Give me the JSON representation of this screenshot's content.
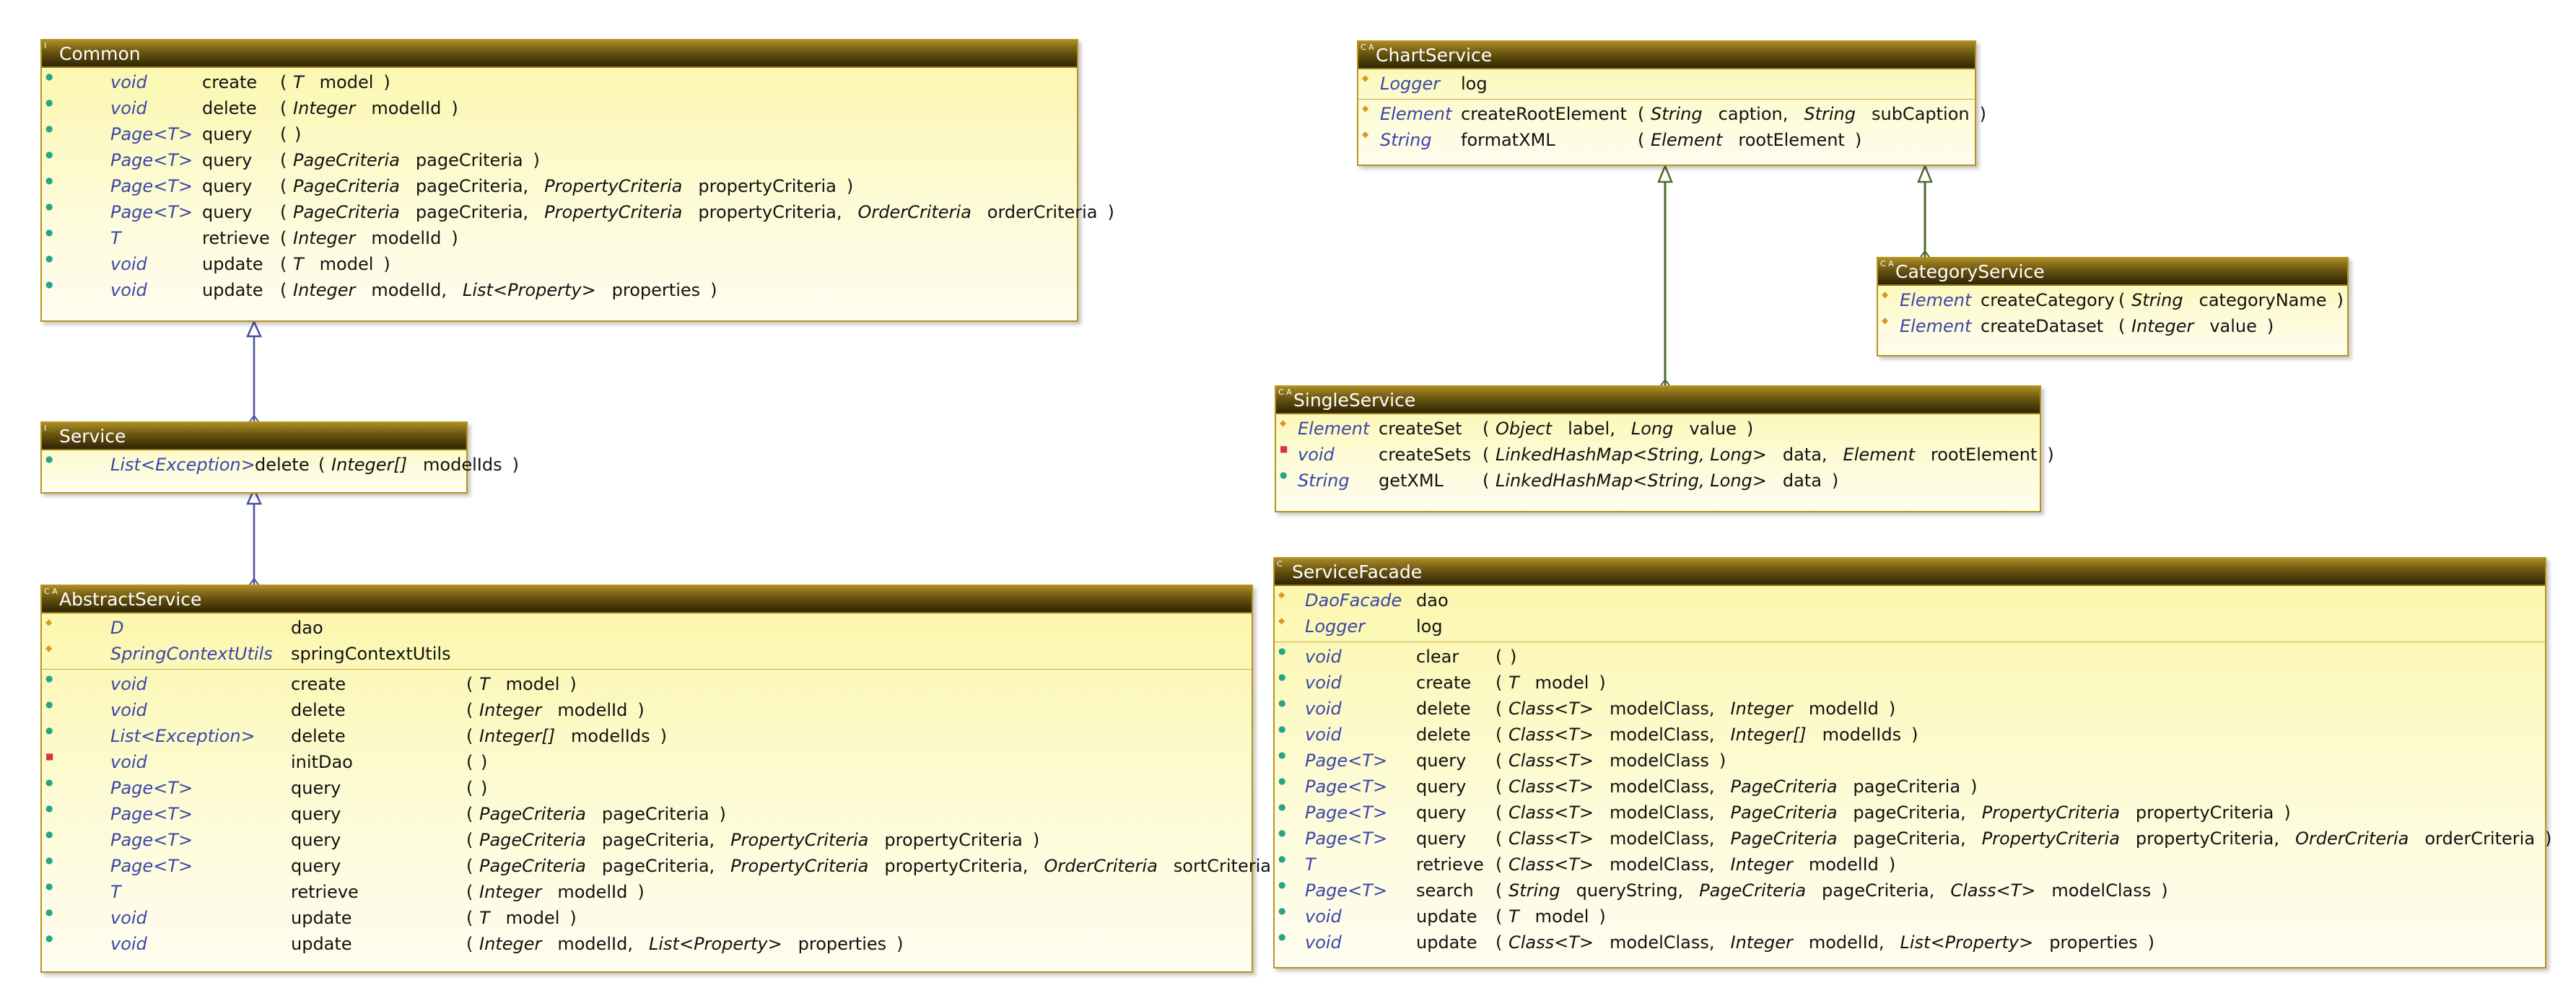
{
  "classes": {
    "common": {
      "name": "Common",
      "badge": "I",
      "operations": [
        {
          "vis": "+",
          "type": "void",
          "name": "create",
          "params": [
            {
              "t": "T",
              "n": "model"
            }
          ]
        },
        {
          "vis": "+",
          "type": "void",
          "name": "delete",
          "params": [
            {
              "t": "Integer",
              "n": "modelId"
            }
          ]
        },
        {
          "vis": "+",
          "type": "Page<T>",
          "name": "query",
          "params": []
        },
        {
          "vis": "+",
          "type": "Page<T>",
          "name": "query",
          "params": [
            {
              "t": "PageCriteria",
              "n": "pageCriteria"
            }
          ]
        },
        {
          "vis": "+",
          "type": "Page<T>",
          "name": "query",
          "params": [
            {
              "t": "PageCriteria",
              "n": "pageCriteria,"
            },
            {
              "t": "PropertyCriteria",
              "n": "propertyCriteria"
            }
          ]
        },
        {
          "vis": "+",
          "type": "Page<T>",
          "name": "query",
          "params": [
            {
              "t": "PageCriteria",
              "n": "pageCriteria,"
            },
            {
              "t": "PropertyCriteria",
              "n": "propertyCriteria,"
            },
            {
              "t": "OrderCriteria",
              "n": "orderCriteria"
            }
          ]
        },
        {
          "vis": "+",
          "type": "T",
          "name": "retrieve",
          "params": [
            {
              "t": "Integer",
              "n": "modelId"
            }
          ]
        },
        {
          "vis": "+",
          "type": "void",
          "name": "update",
          "params": [
            {
              "t": "T",
              "n": "model"
            }
          ]
        },
        {
          "vis": "+",
          "type": "void",
          "name": "update",
          "params": [
            {
              "t": "Integer",
              "n": "modelId,"
            },
            {
              "t": "List<Property>",
              "n": "properties"
            }
          ]
        }
      ]
    },
    "service": {
      "name": "Service",
      "badge": "I",
      "operations": [
        {
          "vis": "+",
          "type": "List<Exception>",
          "name": "delete",
          "params": [
            {
              "t": "Integer[]",
              "n": "modelIds"
            }
          ]
        }
      ]
    },
    "abstract_service": {
      "name": "AbstractService",
      "badge": "C A",
      "fields": [
        {
          "vis": "#",
          "type": "D",
          "name": "dao"
        },
        {
          "vis": "#",
          "type": "SpringContextUtils",
          "name": "springContextUtils"
        }
      ],
      "operations": [
        {
          "vis": "+",
          "type": "void",
          "name": "create",
          "params": [
            {
              "t": "T",
              "n": "model"
            }
          ]
        },
        {
          "vis": "+",
          "type": "void",
          "name": "delete",
          "params": [
            {
              "t": "Integer",
              "n": "modelId"
            }
          ]
        },
        {
          "vis": "+",
          "type": "List<Exception>",
          "name": "delete",
          "params": [
            {
              "t": "Integer[]",
              "n": "modelIds"
            }
          ]
        },
        {
          "vis": "-",
          "type": "void",
          "name": "initDao",
          "params": []
        },
        {
          "vis": "+",
          "type": "Page<T>",
          "name": "query",
          "params": []
        },
        {
          "vis": "+",
          "type": "Page<T>",
          "name": "query",
          "params": [
            {
              "t": "PageCriteria",
              "n": "pageCriteria"
            }
          ]
        },
        {
          "vis": "+",
          "type": "Page<T>",
          "name": "query",
          "params": [
            {
              "t": "PageCriteria",
              "n": "pageCriteria,"
            },
            {
              "t": "PropertyCriteria",
              "n": "propertyCriteria"
            }
          ]
        },
        {
          "vis": "+",
          "type": "Page<T>",
          "name": "query",
          "params": [
            {
              "t": "PageCriteria",
              "n": "pageCriteria,"
            },
            {
              "t": "PropertyCriteria",
              "n": "propertyCriteria,"
            },
            {
              "t": "OrderCriteria",
              "n": "sortCriteria"
            }
          ]
        },
        {
          "vis": "+",
          "type": "T",
          "name": "retrieve",
          "params": [
            {
              "t": "Integer",
              "n": "modelId"
            }
          ]
        },
        {
          "vis": "+",
          "type": "void",
          "name": "update",
          "params": [
            {
              "t": "T",
              "n": "model"
            }
          ]
        },
        {
          "vis": "+",
          "type": "void",
          "name": "update",
          "params": [
            {
              "t": "Integer",
              "n": "modelId,"
            },
            {
              "t": "List<Property>",
              "n": "properties"
            }
          ]
        }
      ]
    },
    "chart_service": {
      "name": "ChartService",
      "badge": "C A",
      "fields": [
        {
          "vis": "#",
          "type": "Logger",
          "name": "log"
        }
      ],
      "operations": [
        {
          "vis": "#",
          "type": "Element",
          "name": "createRootElement",
          "params": [
            {
              "t": "String",
              "n": "caption,"
            },
            {
              "t": "String",
              "n": "subCaption"
            }
          ]
        },
        {
          "vis": "#",
          "type": "String",
          "name": "formatXML",
          "params": [
            {
              "t": "Element",
              "n": "rootElement"
            }
          ]
        }
      ]
    },
    "category_service": {
      "name": "CategoryService",
      "badge": "C A",
      "operations": [
        {
          "vis": "#",
          "type": "Element",
          "name": "createCategory",
          "params": [
            {
              "t": "String",
              "n": "categoryName"
            }
          ]
        },
        {
          "vis": "#",
          "type": "Element",
          "name": "createDataset",
          "params": [
            {
              "t": "Integer",
              "n": "value"
            }
          ]
        }
      ]
    },
    "single_service": {
      "name": "SingleService",
      "badge": "C A",
      "operations": [
        {
          "vis": "#",
          "type": "Element",
          "name": "createSet",
          "params": [
            {
              "t": "Object",
              "n": "label,"
            },
            {
              "t": "Long",
              "n": "value"
            }
          ]
        },
        {
          "vis": "-",
          "type": "void",
          "name": "createSets",
          "params": [
            {
              "t": "LinkedHashMap<String, Long>",
              "n": "data,"
            },
            {
              "t": "Element",
              "n": "rootElement"
            }
          ]
        },
        {
          "vis": "+",
          "type": "String",
          "name": "getXML",
          "params": [
            {
              "t": "LinkedHashMap<String, Long>",
              "n": "data"
            }
          ]
        }
      ]
    },
    "service_facade": {
      "name": "ServiceFacade",
      "badge": "C",
      "fields": [
        {
          "vis": "#",
          "type": "DaoFacade",
          "name": "dao"
        },
        {
          "vis": "#",
          "type": "Logger",
          "name": "log"
        }
      ],
      "operations": [
        {
          "vis": "+",
          "type": "void",
          "name": "clear",
          "params": []
        },
        {
          "vis": "+",
          "type": "void",
          "name": "create",
          "params": [
            {
              "t": "T",
              "n": "model"
            }
          ]
        },
        {
          "vis": "+",
          "type": "void",
          "name": "delete",
          "params": [
            {
              "t": "Class<T>",
              "n": "modelClass,"
            },
            {
              "t": "Integer",
              "n": "modelId"
            }
          ]
        },
        {
          "vis": "+",
          "type": "void",
          "name": "delete",
          "params": [
            {
              "t": "Class<T>",
              "n": "modelClass,"
            },
            {
              "t": "Integer[]",
              "n": "modelIds"
            }
          ]
        },
        {
          "vis": "+",
          "type": "Page<T>",
          "name": "query",
          "params": [
            {
              "t": "Class<T>",
              "n": "modelClass"
            }
          ]
        },
        {
          "vis": "+",
          "type": "Page<T>",
          "name": "query",
          "params": [
            {
              "t": "Class<T>",
              "n": "modelClass,"
            },
            {
              "t": "PageCriteria",
              "n": "pageCriteria"
            }
          ]
        },
        {
          "vis": "+",
          "type": "Page<T>",
          "name": "query",
          "params": [
            {
              "t": "Class<T>",
              "n": "modelClass,"
            },
            {
              "t": "PageCriteria",
              "n": "pageCriteria,"
            },
            {
              "t": "PropertyCriteria",
              "n": "propertyCriteria"
            }
          ]
        },
        {
          "vis": "+",
          "type": "Page<T>",
          "name": "query",
          "params": [
            {
              "t": "Class<T>",
              "n": "modelClass,"
            },
            {
              "t": "PageCriteria",
              "n": "pageCriteria,"
            },
            {
              "t": "PropertyCriteria",
              "n": "propertyCriteria,"
            },
            {
              "t": "OrderCriteria",
              "n": "orderCriteria"
            }
          ]
        },
        {
          "vis": "+",
          "type": "T",
          "name": "retrieve",
          "params": [
            {
              "t": "Class<T>",
              "n": "modelClass,"
            },
            {
              "t": "Integer",
              "n": "modelId"
            }
          ]
        },
        {
          "vis": "+",
          "type": "Page<T>",
          "name": "search",
          "params": [
            {
              "t": "String",
              "n": "queryString,"
            },
            {
              "t": "PageCriteria",
              "n": "pageCriteria,"
            },
            {
              "t": "Class<T>",
              "n": "modelClass"
            }
          ]
        },
        {
          "vis": "+",
          "type": "void",
          "name": "update",
          "params": [
            {
              "t": "T",
              "n": "model"
            }
          ]
        },
        {
          "vis": "+",
          "type": "void",
          "name": "update",
          "params": [
            {
              "t": "Class<T>",
              "n": "modelClass,"
            },
            {
              "t": "Integer",
              "n": "modelId,"
            },
            {
              "t": "List<Property>",
              "n": "properties"
            }
          ]
        }
      ]
    }
  },
  "colors": {
    "interface_arrow": "#4a4fa0",
    "inheritance_arrow": "#4c6a2c",
    "header": "#5a4a10",
    "type_text": "#3a46a8"
  }
}
